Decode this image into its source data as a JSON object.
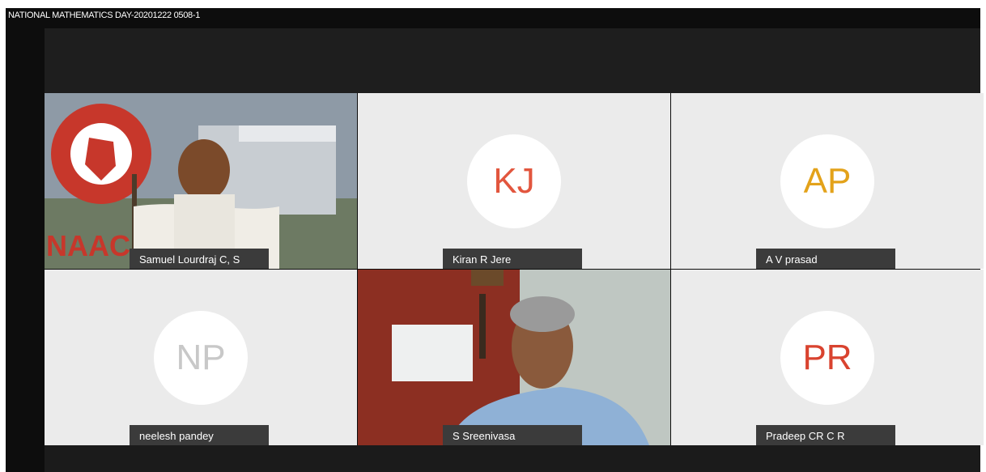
{
  "window": {
    "title": "NATIONAL MATHEMATICS DAY-20201222 0508-1"
  },
  "participants": [
    {
      "name": "Samuel Lourdraj C, S",
      "type": "video"
    },
    {
      "name": "Kiran R Jere",
      "initials": "KJ",
      "color": "#e2563e",
      "type": "avatar"
    },
    {
      "name": "A V prasad",
      "initials": "AP",
      "color": "#e3a21a",
      "type": "avatar"
    },
    {
      "name": "neelesh pandey",
      "initials": "NP",
      "color": "#c8c8c8",
      "type": "avatar"
    },
    {
      "name": "S Sreenivasa",
      "type": "video"
    },
    {
      "name": "Pradeep CR C R",
      "initials": "PR",
      "color": "#d9432f",
      "type": "avatar"
    }
  ],
  "scene": {
    "logo_text": "NAAC"
  }
}
